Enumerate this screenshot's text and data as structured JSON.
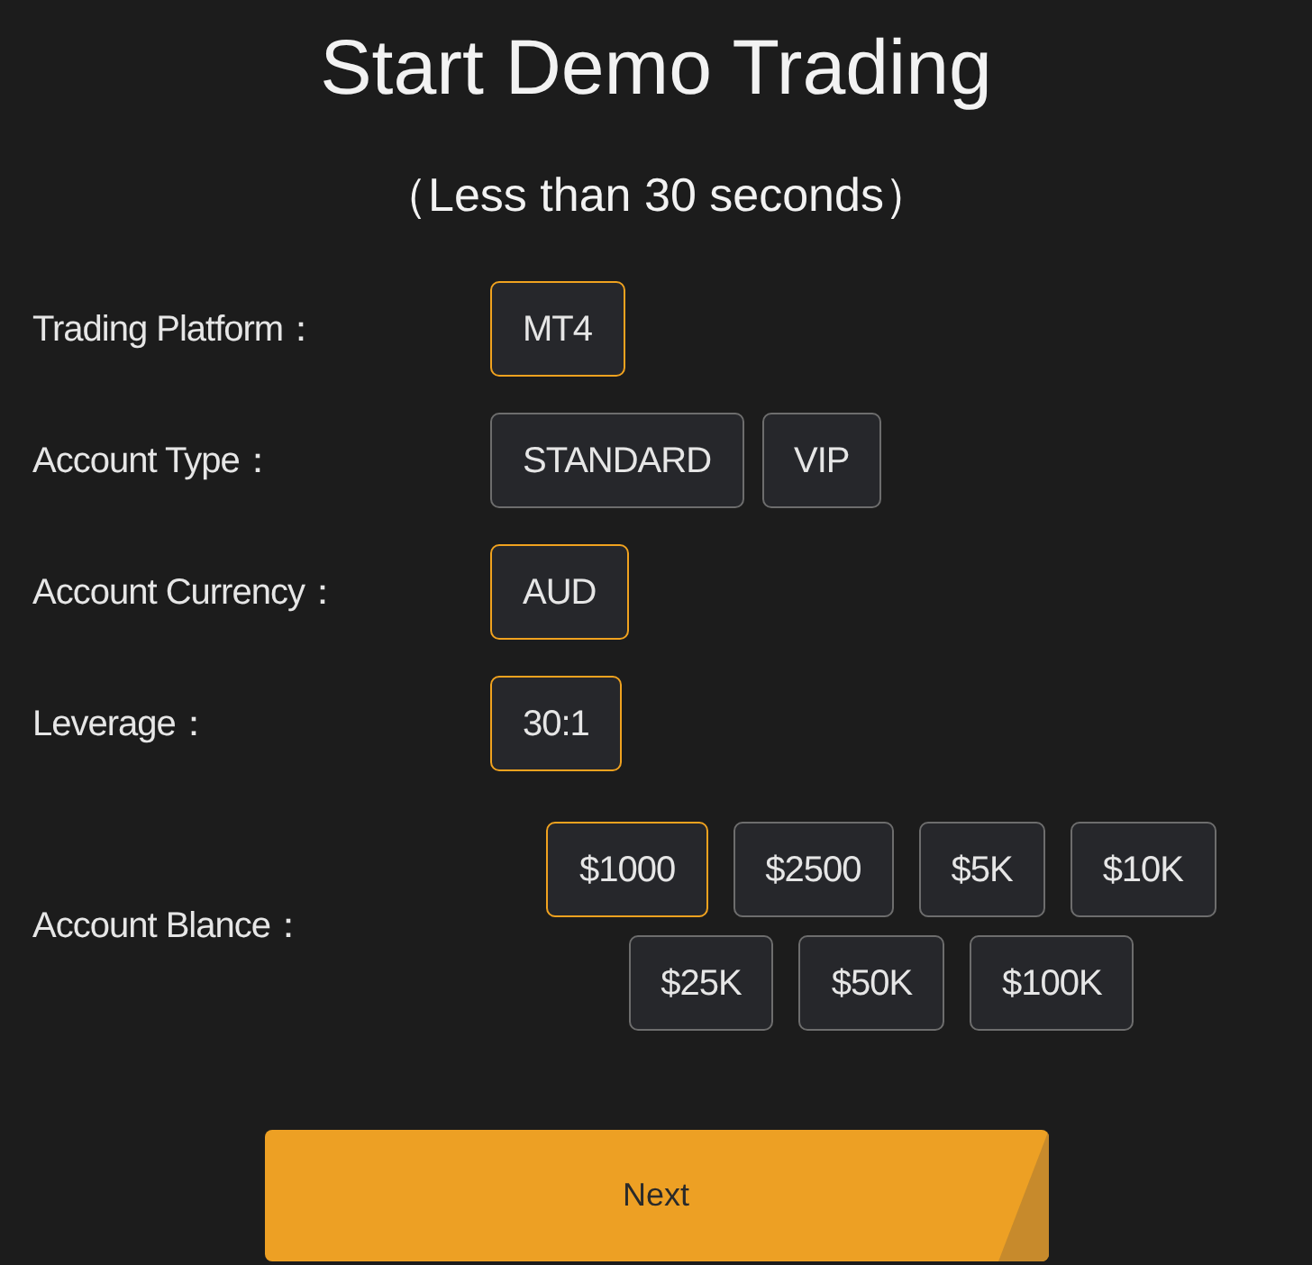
{
  "title": "Start Demo Trading",
  "subtitle": "（Less than 30 seconds）",
  "fields": [
    {
      "kind": "inline",
      "label": "Trading Platform：",
      "options": [
        {
          "label": "MT4",
          "selected": true
        }
      ]
    },
    {
      "kind": "inline",
      "label": "Account Type：",
      "options": [
        {
          "label": "STANDARD",
          "selected": false
        },
        {
          "label": "VIP",
          "selected": false
        }
      ]
    },
    {
      "kind": "inline",
      "label": "Account Currency：",
      "options": [
        {
          "label": "AUD",
          "selected": true
        }
      ]
    },
    {
      "kind": "inline",
      "label": "Leverage：",
      "options": [
        {
          "label": "30:1",
          "selected": true
        }
      ]
    },
    {
      "kind": "wrap",
      "label": "Account Blance：",
      "options": [
        {
          "label": "$1000",
          "selected": true
        },
        {
          "label": "$2500",
          "selected": false
        },
        {
          "label": "$5K",
          "selected": false
        },
        {
          "label": "$10K",
          "selected": false
        },
        {
          "label": "$25K",
          "selected": false
        },
        {
          "label": "$50K",
          "selected": false
        },
        {
          "label": "$100K",
          "selected": false
        }
      ]
    }
  ],
  "next_button": "Next"
}
